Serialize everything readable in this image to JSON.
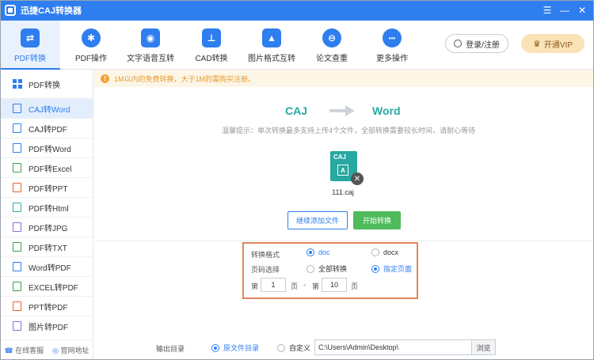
{
  "window": {
    "title": "迅捷CAJ转换器",
    "controls": [
      "☰",
      "—",
      "✕"
    ]
  },
  "toolbar": {
    "items": [
      {
        "label": "PDF转换",
        "color": "#2e7ef0",
        "glyph": "⇄",
        "active": true
      },
      {
        "label": "PDF操作",
        "color": "#2e7ef0",
        "glyph": "✱"
      },
      {
        "label": "文字语音互转",
        "color": "#2e7ef0",
        "glyph": "◉"
      },
      {
        "label": "CAD转换",
        "color": "#2e7ef0",
        "glyph": "⊥"
      },
      {
        "label": "图片格式互转",
        "color": "#2e7ef0",
        "glyph": "▲"
      },
      {
        "label": "论文查重",
        "color": "#2e7ef0",
        "glyph": "⊖"
      },
      {
        "label": "更多操作",
        "color": "#2e7ef0",
        "glyph": "•••"
      }
    ],
    "login": "登录/注册",
    "vip": "开通VIP"
  },
  "sidebar": {
    "header": "PDF转换",
    "items": [
      {
        "label": "CAJ转Word",
        "active": true,
        "color": "#2e7ef0"
      },
      {
        "label": "CAJ转PDF",
        "color": "#2e7ef0"
      },
      {
        "label": "PDF转Word",
        "color": "#2e7ef0"
      },
      {
        "label": "PDF转Excel",
        "color": "#3aa04a"
      },
      {
        "label": "PDF转PPT",
        "color": "#e8612e"
      },
      {
        "label": "PDF转Html",
        "color": "#2fb2a2"
      },
      {
        "label": "PDF转JPG",
        "color": "#8a6fd6"
      },
      {
        "label": "PDF转TXT",
        "color": "#3aa04a"
      },
      {
        "label": "Word转PDF",
        "color": "#2e7ef0"
      },
      {
        "label": "EXCEL转PDF",
        "color": "#3aa04a"
      },
      {
        "label": "PPT转PDF",
        "color": "#e8612e"
      },
      {
        "label": "图片转PDF",
        "color": "#8a6fd6"
      }
    ],
    "footer": {
      "service": "在线客服",
      "website": "官网地址"
    }
  },
  "main": {
    "notice": "1M以内的免费转换，大于1M的需购买注册。",
    "from": "CAJ",
    "to": "Word",
    "tip": "温馨提示：单次转换最多支持上传4个文件，全部转换需要较长时间，请耐心等待",
    "file": {
      "type": "CAJ",
      "badge": "A",
      "name": "111.caj"
    },
    "add_button": "继续添加文件",
    "start_button": "开始转换"
  },
  "options": {
    "format_label": "转换格式",
    "format_doc": "doc",
    "format_docx": "docx",
    "pages_label": "页码选择",
    "pages_all": "全部转换",
    "pages_custom": "指定页面",
    "from_prefix": "第",
    "from_value": "1",
    "page_unit": "页",
    "dash": "-",
    "to_prefix": "第",
    "to_value": "10"
  },
  "output": {
    "label": "输出目录",
    "original": "原文件目录",
    "custom": "自定义",
    "path": "C:\\Users\\Admin\\Desktop\\",
    "browse": "浏览"
  }
}
